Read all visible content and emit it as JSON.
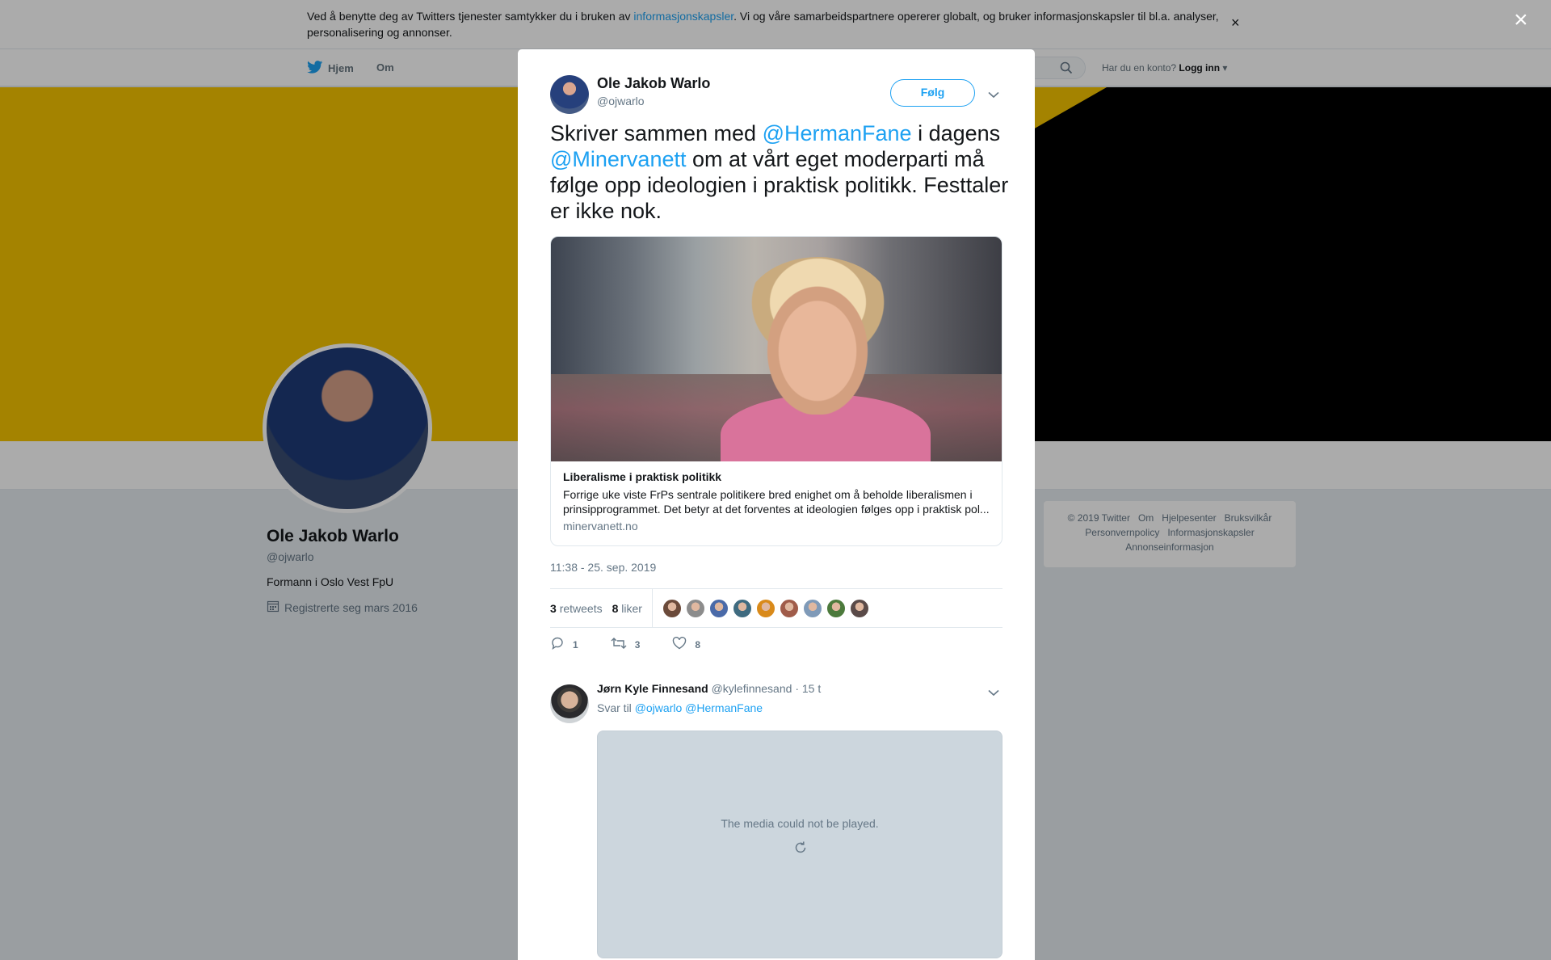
{
  "cookie_banner": {
    "text_before": "Ved å benytte deg av Twitters tjenester samtykker du i bruken av ",
    "link": "informasjonskapsler",
    "text_after": ". Vi og våre samarbeidspartnere opererer globalt, og bruker informasjonskapsler til bl.a. analyser, personalisering og annonser.",
    "close": "×"
  },
  "nav": {
    "home": "Hjem",
    "about": "Om",
    "account_prompt": "Har du en konto?",
    "login": "Logg inn"
  },
  "profile": {
    "name": "Ole Jakob Warlo",
    "handle": "@ojwarlo",
    "bio": "Formann i Oslo Vest FpU",
    "joined": "Registrerte seg mars 2016"
  },
  "footer": {
    "links": [
      "© 2019 Twitter",
      "Om",
      "Hjelpesenter",
      "Bruksvilkår",
      "Personvernpolicy",
      "Informasjonskapsler",
      "Annonseinformasjon"
    ]
  },
  "overlay_close": "×",
  "tweet": {
    "author_name": "Ole Jakob Warlo",
    "author_handle": "@ojwarlo",
    "follow_label": "Følg",
    "text_1": "Skriver sammen med ",
    "mention_1": "@HermanFane",
    "text_2": " i dagens ",
    "mention_2": "@Minervanett",
    "text_3": " om at vårt eget moderparti må følge opp ideologien i praktisk politikk. Festtaler er ikke nok.",
    "card": {
      "title": "Liberalisme i praktisk politikk",
      "description": "Forrige uke viste FrPs sentrale politikere bred enighet om å beholde liberalismen i prinsipprogrammet. Det betyr at det forventes at ideologien følges opp i praktisk pol...",
      "domain": "minervanett.no"
    },
    "timestamp": "11:38 - 25. sep. 2019",
    "retweets_count": "3",
    "retweets_label": "retweets",
    "likes_count": "8",
    "likes_label": "liker",
    "liker_avatar_colors": [
      "#6b4a3a",
      "#8c8c8c",
      "#4a6aa8",
      "#3f6b80",
      "#d98a1a",
      "#a05c4a",
      "#7f9ab8",
      "#4c7a3c",
      "#5a4a48"
    ],
    "actions": {
      "replies": "1",
      "retweets": "3",
      "likes": "8"
    }
  },
  "reply": {
    "name": "Jørn Kyle Finnesand",
    "handle": "@kylefinnesand",
    "time": "· 15 t",
    "reply_to_label": "Svar til ",
    "reply_to_1": "@ojwarlo",
    "reply_to_2": "@HermanFane",
    "media_error": "The media could not be played."
  },
  "colors": {
    "accent": "#1da1f2",
    "banner_yellow": "#f5c400"
  }
}
